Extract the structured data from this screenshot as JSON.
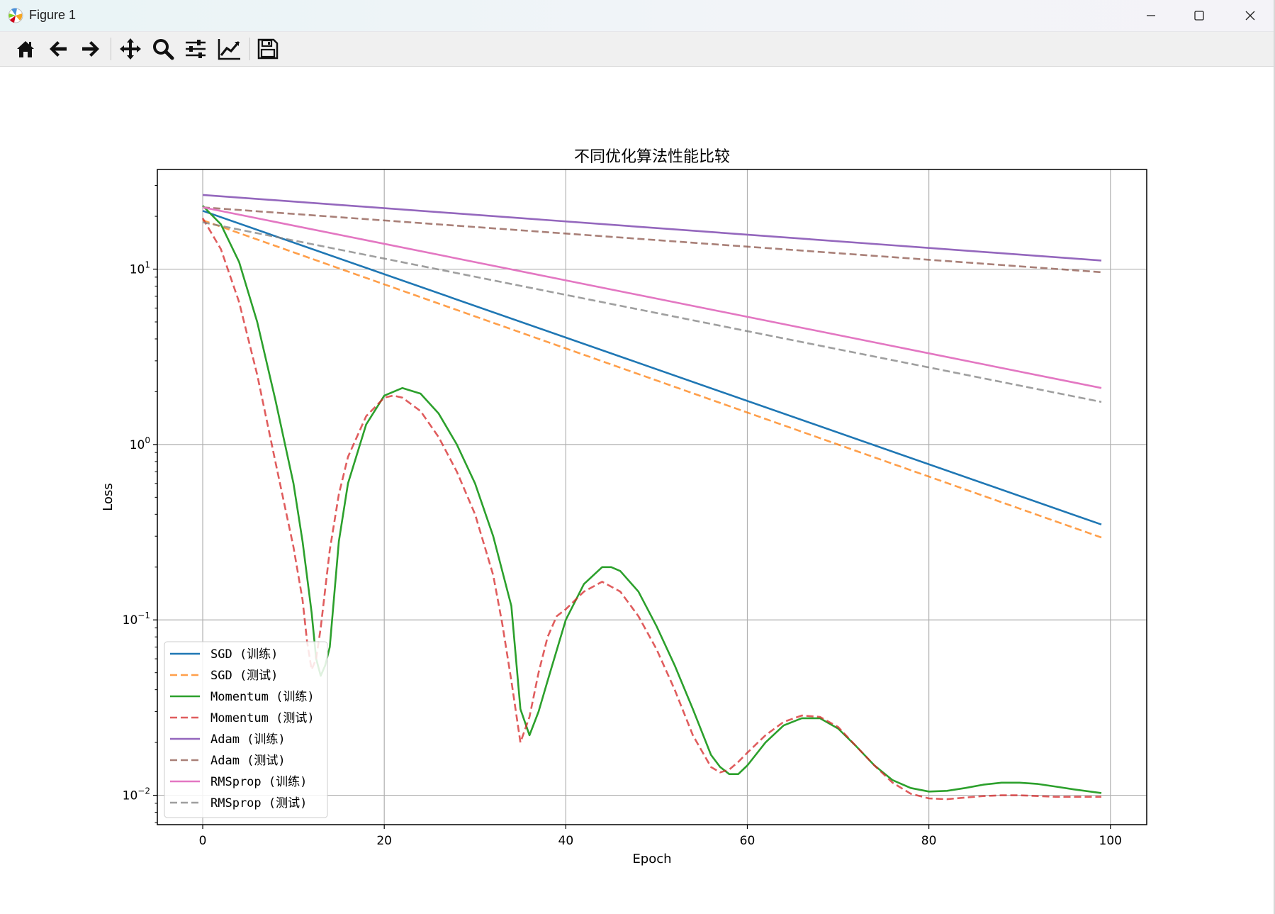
{
  "window": {
    "title": "Figure 1",
    "app_icon": "matplotlib-icon",
    "controls": [
      "minimize-icon",
      "maximize-icon",
      "close-icon"
    ]
  },
  "toolbar": {
    "buttons": [
      {
        "name": "home-button",
        "icon": "home-icon"
      },
      {
        "name": "back-button",
        "icon": "arrow-left-icon"
      },
      {
        "name": "forward-button",
        "icon": "arrow-right-icon"
      },
      {
        "name": "pan-button",
        "icon": "move-arrows-icon"
      },
      {
        "name": "zoom-button",
        "icon": "magnifier-icon"
      },
      {
        "name": "subplots-button",
        "icon": "sliders-icon"
      },
      {
        "name": "customize-button",
        "icon": "line-chart-icon"
      },
      {
        "name": "save-button",
        "icon": "floppy-disk-icon"
      }
    ]
  },
  "chart_data": {
    "type": "line",
    "title": "不同优化算法性能比较",
    "xlabel": "Epoch",
    "ylabel": "Loss",
    "yscale": "log",
    "xlim": [
      -5,
      104
    ],
    "ylim": [
      0.0068,
      37
    ],
    "xticks": [
      0,
      20,
      40,
      60,
      80,
      100
    ],
    "xtick_labels": [
      "0",
      "20",
      "40",
      "60",
      "80",
      "100"
    ],
    "yticks": [
      0.01,
      0.1,
      1,
      10
    ],
    "ytick_labels": [
      {
        "base": "10",
        "exp": "−2"
      },
      {
        "base": "10",
        "exp": "−1"
      },
      {
        "base": "10",
        "exp": "0"
      },
      {
        "base": "10",
        "exp": "1"
      }
    ],
    "grid": true,
    "legend_position": "lower left",
    "series": [
      {
        "name": "SGD (训练)",
        "color": "#1f77b4",
        "dash": "solid",
        "x": [
          0,
          99
        ],
        "y": [
          21.5,
          0.35
        ]
      },
      {
        "name": "SGD (测试)",
        "color": "#ff7f0e",
        "dash": "dashed",
        "x": [
          0,
          99
        ],
        "y": [
          19.0,
          0.295
        ]
      },
      {
        "name": "Momentum (训练)",
        "color": "#2ca02c",
        "dash": "solid",
        "x": [
          0,
          2,
          4,
          6,
          8,
          10,
          11,
          12,
          12.5,
          13,
          13.5,
          14,
          15,
          16,
          18,
          20,
          22,
          24,
          26,
          28,
          30,
          32,
          34,
          35,
          36,
          37,
          38,
          40,
          42,
          44,
          45,
          46,
          48,
          50,
          52,
          54,
          56,
          57,
          58,
          59,
          60,
          62,
          64,
          66,
          68,
          70,
          72,
          74,
          76,
          78,
          80,
          82,
          84,
          86,
          88,
          90,
          92,
          94,
          96,
          99
        ],
        "y": [
          23,
          18,
          11,
          5.0,
          1.8,
          0.6,
          0.28,
          0.11,
          0.06,
          0.048,
          0.055,
          0.07,
          0.28,
          0.6,
          1.3,
          1.9,
          2.1,
          1.95,
          1.5,
          1.0,
          0.6,
          0.3,
          0.12,
          0.031,
          0.022,
          0.03,
          0.045,
          0.1,
          0.16,
          0.2,
          0.2,
          0.19,
          0.145,
          0.092,
          0.055,
          0.031,
          0.017,
          0.0145,
          0.0132,
          0.0132,
          0.0148,
          0.02,
          0.025,
          0.0275,
          0.0275,
          0.024,
          0.019,
          0.0148,
          0.0122,
          0.011,
          0.0105,
          0.0106,
          0.011,
          0.0115,
          0.0118,
          0.0118,
          0.0116,
          0.0112,
          0.0108,
          0.0103
        ]
      },
      {
        "name": "Momentum (测试)",
        "color": "#d62728",
        "dash": "dashed",
        "x": [
          0,
          2,
          4,
          6,
          8,
          10,
          11,
          11.5,
          12,
          12.5,
          13,
          14,
          15,
          16,
          18,
          20,
          21,
          22,
          24,
          26,
          28,
          30,
          32,
          33,
          34,
          35,
          36,
          37,
          38,
          39,
          40,
          42,
          44,
          46,
          48,
          50,
          52,
          54,
          56,
          57,
          58,
          59,
          60,
          62,
          64,
          66,
          68,
          70,
          72,
          74,
          76,
          78,
          80,
          82,
          84,
          86,
          88,
          90,
          92,
          94,
          96,
          99
        ],
        "y": [
          19.5,
          13,
          6.5,
          2.5,
          0.8,
          0.26,
          0.13,
          0.075,
          0.052,
          0.06,
          0.09,
          0.25,
          0.52,
          0.85,
          1.45,
          1.85,
          1.9,
          1.85,
          1.55,
          1.1,
          0.7,
          0.4,
          0.18,
          0.095,
          0.045,
          0.02,
          0.028,
          0.05,
          0.08,
          0.105,
          0.115,
          0.145,
          0.165,
          0.145,
          0.105,
          0.068,
          0.04,
          0.022,
          0.0145,
          0.0135,
          0.014,
          0.0155,
          0.0175,
          0.022,
          0.0262,
          0.0285,
          0.028,
          0.0245,
          0.019,
          0.0148,
          0.0118,
          0.0102,
          0.0096,
          0.0095,
          0.0097,
          0.0099,
          0.01,
          0.01,
          0.0099,
          0.0098,
          0.0098,
          0.0098
        ]
      },
      {
        "name": "Adam (训练)",
        "color": "#9467bd",
        "dash": "solid",
        "x": [
          0,
          99
        ],
        "y": [
          26.5,
          11.2
        ]
      },
      {
        "name": "Adam (测试)",
        "color": "#8c564b",
        "dash": "dashed",
        "x": [
          0,
          99
        ],
        "y": [
          22.5,
          9.6
        ]
      },
      {
        "name": "RMSprop (训练)",
        "color": "#e377c2",
        "dash": "solid",
        "x": [
          0,
          99
        ],
        "y": [
          22.5,
          2.1
        ]
      },
      {
        "name": "RMSprop (测试)",
        "color": "#7f7f7f",
        "dash": "dashed",
        "x": [
          0,
          99
        ],
        "y": [
          18.5,
          1.75
        ]
      }
    ]
  }
}
